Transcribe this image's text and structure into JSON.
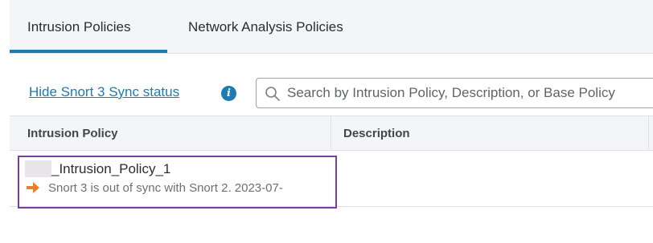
{
  "tabs": [
    {
      "label": "Intrusion Policies",
      "active": true
    },
    {
      "label": "Network Analysis Policies",
      "active": false
    }
  ],
  "toolbar": {
    "sync_link": "Hide Snort 3 Sync status",
    "info_icon": "info-icon",
    "search": {
      "icon": "search-icon",
      "placeholder": "Search by Intrusion Policy, Description, or Base Policy",
      "value": ""
    }
  },
  "table": {
    "columns": [
      "Intrusion Policy",
      "Description"
    ],
    "rows": [
      {
        "policy_name": "_Intrusion_Policy_1",
        "status_icon": "arrow-right-icon",
        "status_text": "Snort 3 is out of sync with Snort 2. 2023-07-",
        "description": ""
      }
    ]
  },
  "colors": {
    "accent": "#1d7ab3",
    "highlight_border": "#7b3e9e",
    "status_arrow": "#f07e26"
  }
}
